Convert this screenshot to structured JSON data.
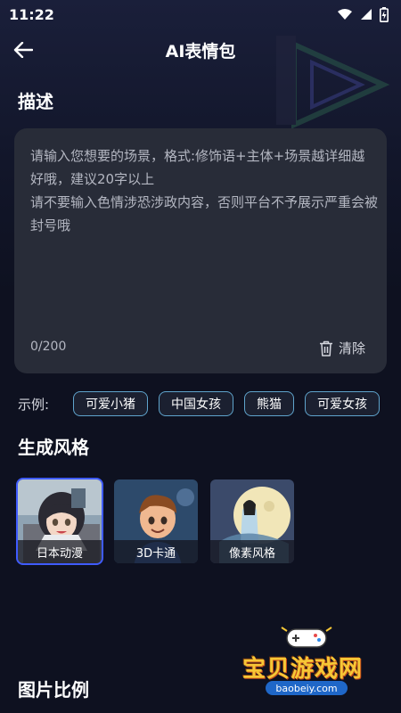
{
  "status_bar": {
    "time": "11:22",
    "icons": [
      "wifi-icon",
      "cellular-icon",
      "battery-charging-icon"
    ]
  },
  "header": {
    "title": "AI表情包",
    "back_icon": "arrow-left-icon"
  },
  "description": {
    "section_title": "描述",
    "placeholder_line1": "请输入您想要的场景，格式:修饰语+主体+场景越详细越好哦，建议20字以上",
    "placeholder_line2": "请不要输入色情涉恐涉政内容，否则平台不予展示严重会被封号哦",
    "counter": "0/200",
    "clear_label": "清除",
    "clear_icon": "trash-icon"
  },
  "examples": {
    "label": "示例:",
    "chips": [
      "可爱小猪",
      "中国女孩",
      "熊猫",
      "可爱女孩"
    ]
  },
  "style": {
    "section_title": "生成风格",
    "options": [
      {
        "label": "日本动漫",
        "selected": true
      },
      {
        "label": "3D卡通",
        "selected": false
      },
      {
        "label": "像素风格",
        "selected": false
      }
    ]
  },
  "ratio": {
    "section_title": "图片比例"
  },
  "watermark": {
    "text": "宝贝游戏网",
    "url": "baobeiy.com"
  },
  "colors": {
    "background": "#0e1120",
    "card": "#282c38",
    "chip_border": "#5fa4cc",
    "selected_border": "#3f5bff"
  }
}
